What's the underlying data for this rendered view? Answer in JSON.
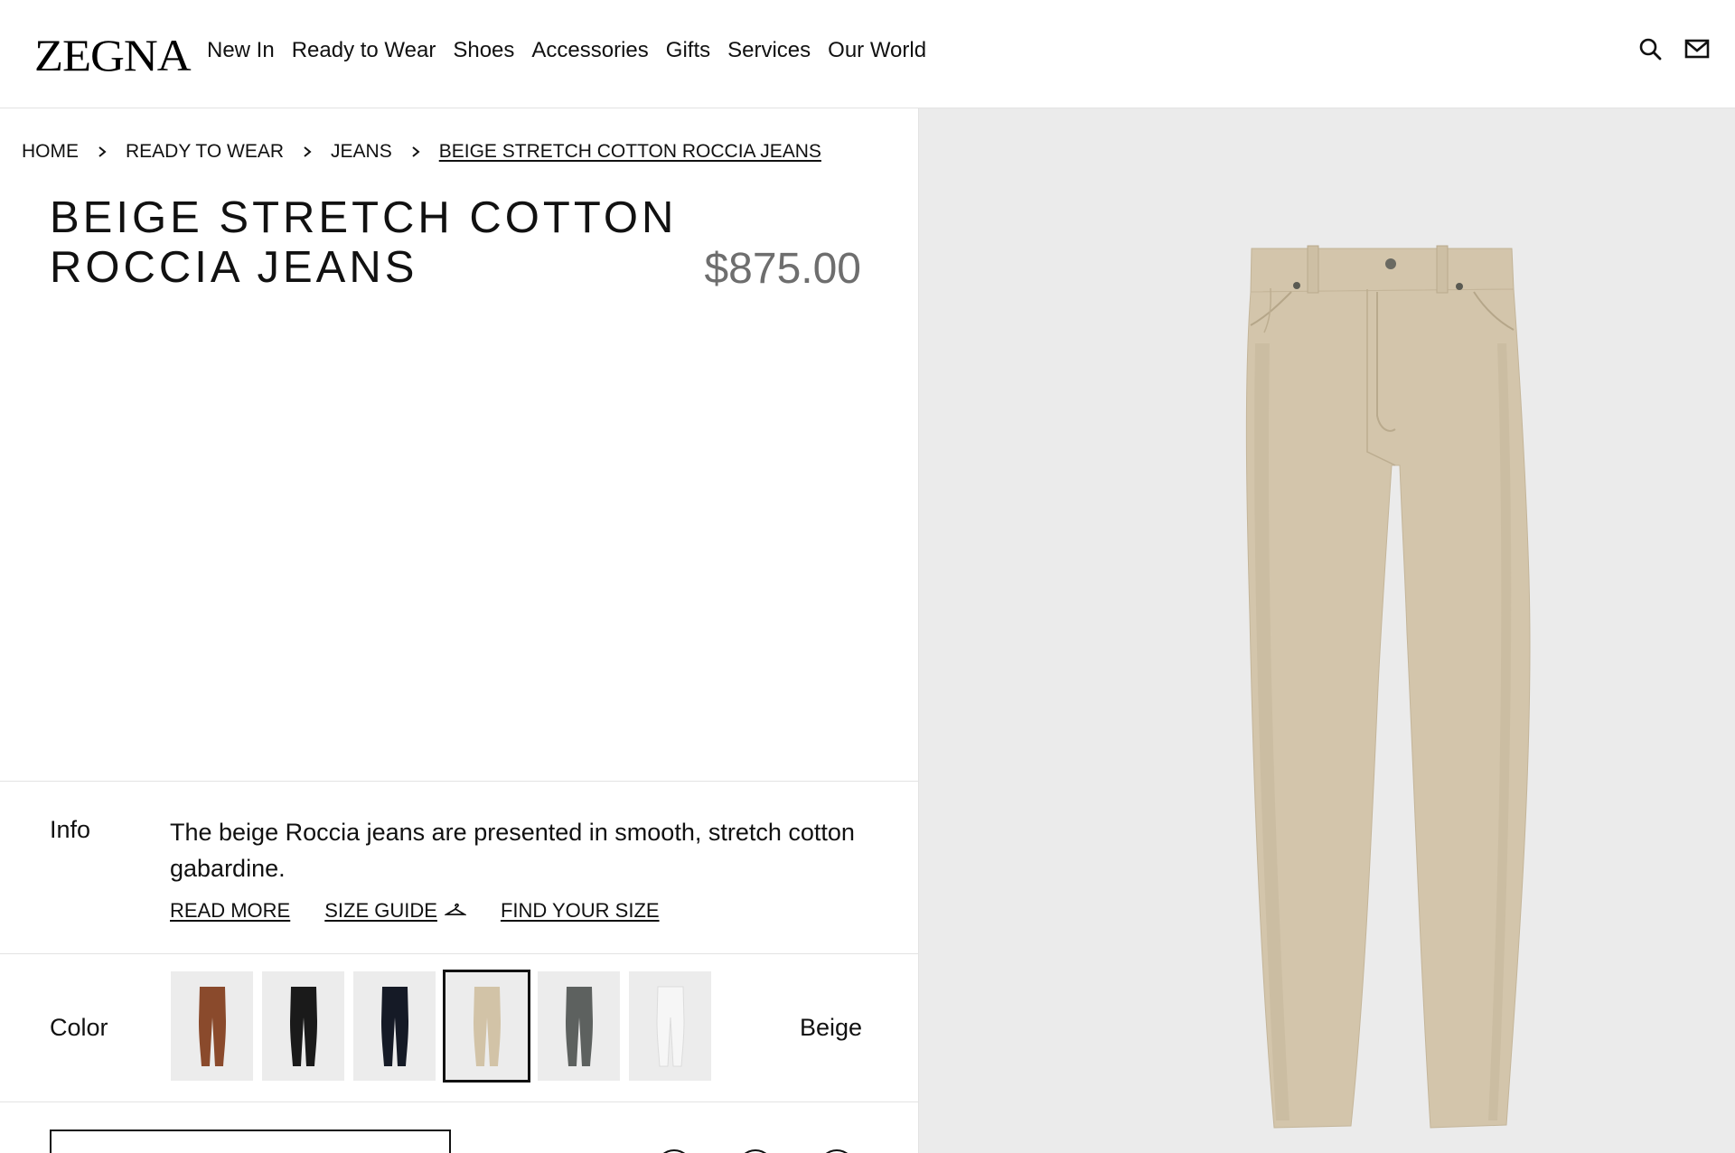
{
  "header": {
    "logo": "ZEGNA",
    "nav": [
      "New In",
      "Ready to Wear",
      "Shoes",
      "Accessories",
      "Gifts",
      "Services",
      "Our World"
    ],
    "icons": [
      "search-icon",
      "mail-icon"
    ]
  },
  "breadcrumb": [
    "HOME",
    "READY TO WEAR",
    "JEANS",
    "BEIGE STRETCH COTTON ROCCIA JEANS"
  ],
  "product": {
    "title_line1": "BEIGE STRETCH COTTON",
    "title_line2": "ROCCIA JEANS",
    "price": "$875.00"
  },
  "info": {
    "label": "Info",
    "text": "The beige Roccia jeans are presented in smooth, stretch cotton gabardine.",
    "read_more": "READ MORE",
    "size_guide": "SIZE GUIDE",
    "find_size": "FIND YOUR SIZE"
  },
  "color": {
    "label": "Color",
    "selected": "Beige",
    "swatches": [
      {
        "name": "brown",
        "hex": "#8a4a2c"
      },
      {
        "name": "black",
        "hex": "#1a1a1a"
      },
      {
        "name": "navy",
        "hex": "#151a26"
      },
      {
        "name": "beige",
        "hex": "#d2c3a7",
        "selected": true
      },
      {
        "name": "grey",
        "hex": "#5d615f"
      },
      {
        "name": "white",
        "hex": "#f6f6f6"
      }
    ]
  },
  "colors": {
    "image_background": "#ebebeb",
    "price": "#6e6e6e",
    "jeans": "#d3c5ab"
  }
}
